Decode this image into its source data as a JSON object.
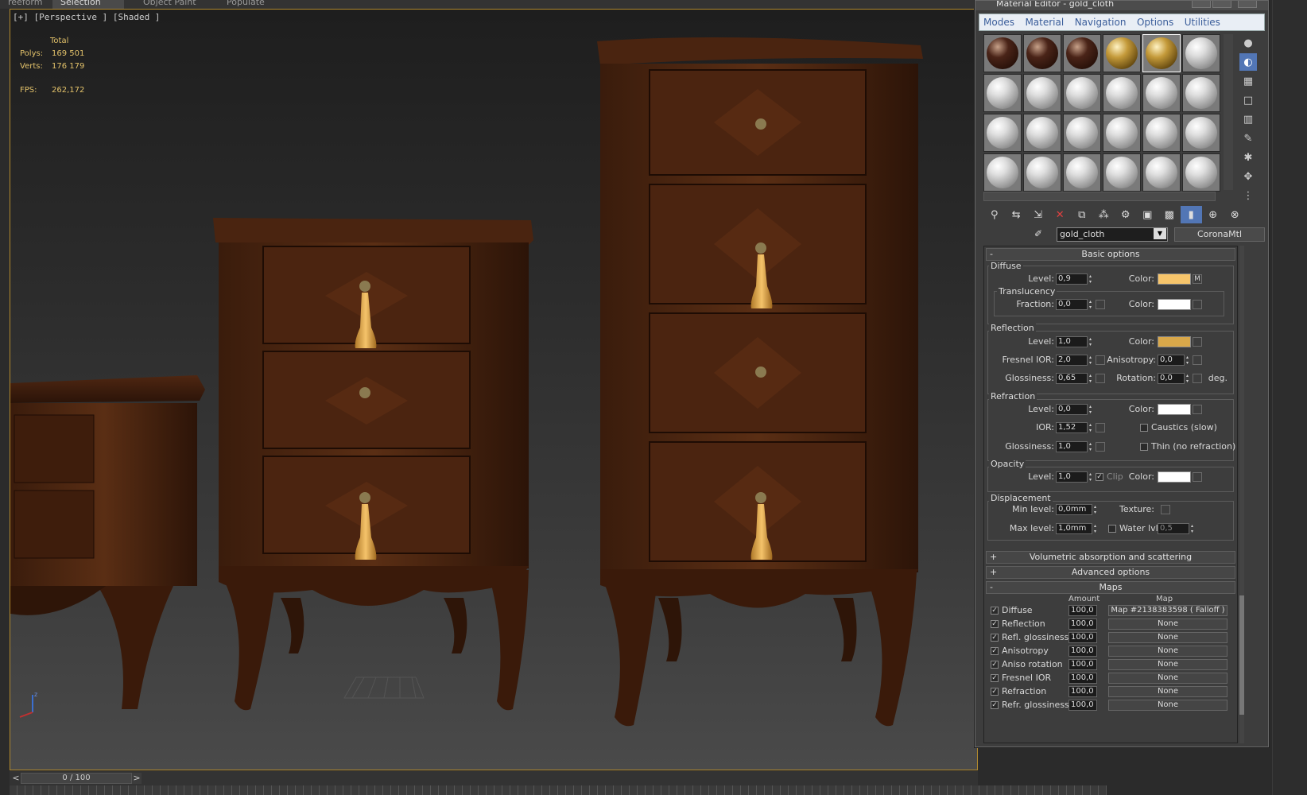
{
  "topbar": {
    "tabs": [
      "reeform",
      "Selection",
      "Object Paint",
      "Populate"
    ]
  },
  "viewport": {
    "label": "[+] [Perspective ] [Shaded ]",
    "stats": {
      "header": "Total",
      "polys_label": "Polys:",
      "polys": "169 501",
      "verts_label": "Verts:",
      "verts": "176 179",
      "fps_label": "FPS:",
      "fps": "262,172"
    },
    "axis": {
      "z": "z",
      "x": "x"
    }
  },
  "timeline": {
    "value": "0 / 100",
    "prev": "<",
    "next": ">"
  },
  "material_editor": {
    "title": "Material Editor - gold_cloth",
    "menu": [
      "Modes",
      "Material",
      "Navigation",
      "Options",
      "Utilities"
    ],
    "material_name": "gold_cloth",
    "material_type": "CoronaMtl",
    "basic_options": {
      "rollout": "Basic options",
      "diffuse": {
        "group": "Diffuse",
        "level_label": "Level:",
        "level": "0,9",
        "color_label": "Color:",
        "color": "#f7c56b",
        "map_marker": "M"
      },
      "translucency": {
        "group": "Translucency",
        "fraction_label": "Fraction:",
        "fraction": "0,0",
        "color_label": "Color:",
        "color": "#ffffff"
      },
      "reflection": {
        "group": "Reflection",
        "level_label": "Level:",
        "level": "1,0",
        "color_label": "Color:",
        "color": "#d9a84a",
        "fresnel_label": "Fresnel IOR:",
        "fresnel": "2,0",
        "aniso_label": "Anisotropy:",
        "aniso": "0,0",
        "gloss_label": "Glossiness:",
        "gloss": "0,65",
        "rotation_label": "Rotation:",
        "rotation": "0,0",
        "deg": "deg."
      },
      "refraction": {
        "group": "Refraction",
        "level_label": "Level:",
        "level": "0,0",
        "color_label": "Color:",
        "color": "#ffffff",
        "ior_label": "IOR:",
        "ior": "1,52",
        "caustics": "Caustics (slow)",
        "gloss_label": "Glossiness:",
        "gloss": "1,0",
        "thin": "Thin (no refraction)"
      },
      "opacity": {
        "group": "Opacity",
        "level_label": "Level:",
        "level": "1,0",
        "clip": "Clip",
        "color_label": "Color:",
        "color": "#ffffff"
      },
      "displacement": {
        "group": "Displacement",
        "min_label": "Min level:",
        "min": "0,0mm",
        "texture_label": "Texture:",
        "max_label": "Max level:",
        "max": "1,0mm",
        "water_label": "Water lvl.",
        "water": "0,5"
      }
    },
    "rollouts": {
      "volumetric": "Volumetric absorption and scattering",
      "advanced": "Advanced options",
      "maps": "Maps"
    },
    "maps": {
      "amount_header": "Amount",
      "map_header": "Map",
      "rows": [
        {
          "name": "Diffuse",
          "amount": "100,0",
          "map": "Map #2138383598  ( Falloff )"
        },
        {
          "name": "Reflection",
          "amount": "100,0",
          "map": "None"
        },
        {
          "name": "Refl. glossiness",
          "amount": "100,0",
          "map": "None"
        },
        {
          "name": "Anisotropy",
          "amount": "100,0",
          "map": "None"
        },
        {
          "name": "Aniso rotation",
          "amount": "100,0",
          "map": "None"
        },
        {
          "name": "Fresnel IOR",
          "amount": "100,0",
          "map": "None"
        },
        {
          "name": "Refraction",
          "amount": "100,0",
          "map": "None"
        },
        {
          "name": "Refr. glossiness",
          "amount": "100,0",
          "map": "None"
        }
      ]
    }
  }
}
